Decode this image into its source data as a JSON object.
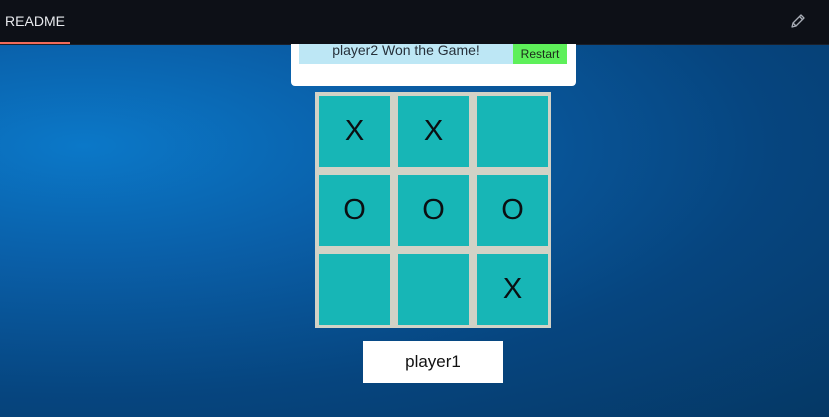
{
  "topbar": {
    "tab_label": "README",
    "edit_icon": "pencil-icon"
  },
  "status": {
    "message": "player2 Won the Game!",
    "restart_label": "Restart"
  },
  "board": {
    "cells": [
      "X",
      "X",
      "",
      "O",
      "O",
      "O",
      "",
      "",
      "X"
    ]
  },
  "current_player": "player1",
  "colors": {
    "topbar": "#0d1017",
    "tab_underline": "#f26b5a",
    "status_bar": "#bde7f5",
    "restart_button": "#5ef05a",
    "cell": "#17b6b6",
    "board_border": "#d2d2c6",
    "background": "#06457f"
  }
}
